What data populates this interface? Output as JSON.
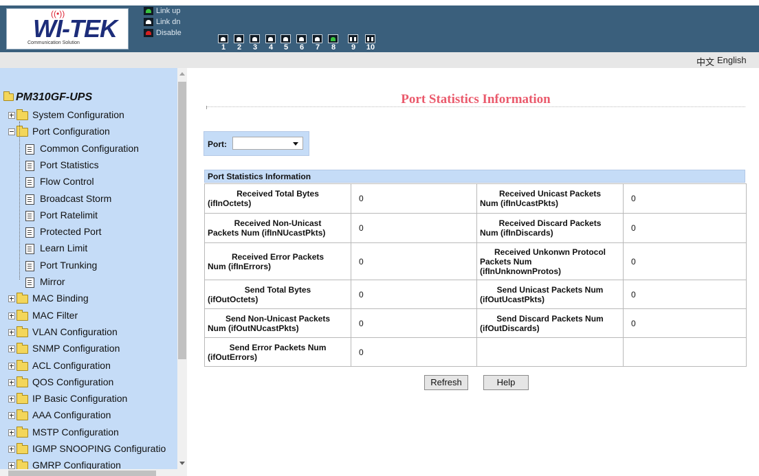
{
  "header": {
    "logo": {
      "brand": "WI-TEK",
      "tagline": "Communication Solution"
    },
    "legend": {
      "link_up": "Link up",
      "link_dn": "Link dn",
      "disable": "Disable"
    },
    "ports": [
      {
        "num": "1",
        "state": "link-dn",
        "kind": "copper"
      },
      {
        "num": "2",
        "state": "link-dn",
        "kind": "copper"
      },
      {
        "num": "3",
        "state": "link-dn",
        "kind": "copper"
      },
      {
        "num": "4",
        "state": "link-dn",
        "kind": "copper"
      },
      {
        "num": "5",
        "state": "link-dn",
        "kind": "copper"
      },
      {
        "num": "6",
        "state": "link-dn",
        "kind": "copper"
      },
      {
        "num": "7",
        "state": "link-dn",
        "kind": "copper"
      },
      {
        "num": "8",
        "state": "link-up",
        "kind": "copper"
      },
      {
        "num": "9",
        "state": "link-dn",
        "kind": "fiber"
      },
      {
        "num": "10",
        "state": "link-dn",
        "kind": "fiber"
      }
    ]
  },
  "lang": {
    "chinese": "中文",
    "english": "English"
  },
  "sidebar": {
    "root": "PM310GF-UPS",
    "items": [
      {
        "label": "System Configuration",
        "type": "folder"
      },
      {
        "label": "Port Configuration",
        "type": "folder-open"
      },
      {
        "label": "Common Configuration",
        "type": "page"
      },
      {
        "label": "Port Statistics",
        "type": "page"
      },
      {
        "label": "Flow Control",
        "type": "page"
      },
      {
        "label": "Broadcast Storm",
        "type": "page"
      },
      {
        "label": "Port Ratelimit",
        "type": "page"
      },
      {
        "label": "Protected Port",
        "type": "page"
      },
      {
        "label": "Learn Limit",
        "type": "page"
      },
      {
        "label": "Port Trunking",
        "type": "page"
      },
      {
        "label": "Mirror",
        "type": "page"
      },
      {
        "label": "MAC Binding",
        "type": "folder"
      },
      {
        "label": "MAC Filter",
        "type": "folder"
      },
      {
        "label": "VLAN Configuration",
        "type": "folder"
      },
      {
        "label": "SNMP Configuration",
        "type": "folder"
      },
      {
        "label": "ACL Configuration",
        "type": "folder"
      },
      {
        "label": "QOS Configuration",
        "type": "folder"
      },
      {
        "label": "IP Basic Configuration",
        "type": "folder"
      },
      {
        "label": "AAA Configuration",
        "type": "folder"
      },
      {
        "label": "MSTP Configuration",
        "type": "folder"
      },
      {
        "label": "IGMP SNOOPING Configuratio",
        "type": "folder"
      },
      {
        "label": "GMRP Configuration",
        "type": "folder"
      }
    ]
  },
  "main": {
    "title": "Port Statistics Information",
    "port_label": "Port:",
    "port_value": "",
    "section_header": "Port Statistics Information",
    "rows": [
      {
        "l1": "Received Total Bytes",
        "l2": "(ifInOctets)",
        "v1": "0",
        "r1": "Received Unicast Packets",
        "r2": "Num (ifInUcastPkts)",
        "v2": "0"
      },
      {
        "l1": "Received Non-Unicast",
        "l2": "Packets Num (ifInNUcastPkts)",
        "v1": "0",
        "r1": "Received Discard Packets",
        "r2": "Num (ifInDiscards)",
        "v2": "0"
      },
      {
        "l1": "Received Error Packets",
        "l2": "Num (ifInErrors)",
        "v1": "0",
        "r1": "Received Unkonwn Protocol",
        "r2": "Packets Num",
        "r3": "(ifInUnknownProtos)",
        "v2": "0"
      },
      {
        "l1": "Send Total Bytes",
        "l2": "(ifOutOctets)",
        "v1": "0",
        "r1": "Send Unicast Packets Num",
        "r2": "(ifOutUcastPkts)",
        "v2": "0"
      },
      {
        "l1": "Send Non-Unicast Packets",
        "l2": "Num (ifOutNUcastPkts)",
        "v1": "0",
        "r1": "Send Discard Packets Num",
        "r2": "(ifOutDiscards)",
        "v2": "0"
      },
      {
        "l1": "Send Error Packets Num",
        "l2": "(ifOutErrors)",
        "v1": "0",
        "r1": "",
        "r2": "",
        "v2": ""
      }
    ],
    "refresh_label": "Refresh",
    "help_label": "Help"
  }
}
